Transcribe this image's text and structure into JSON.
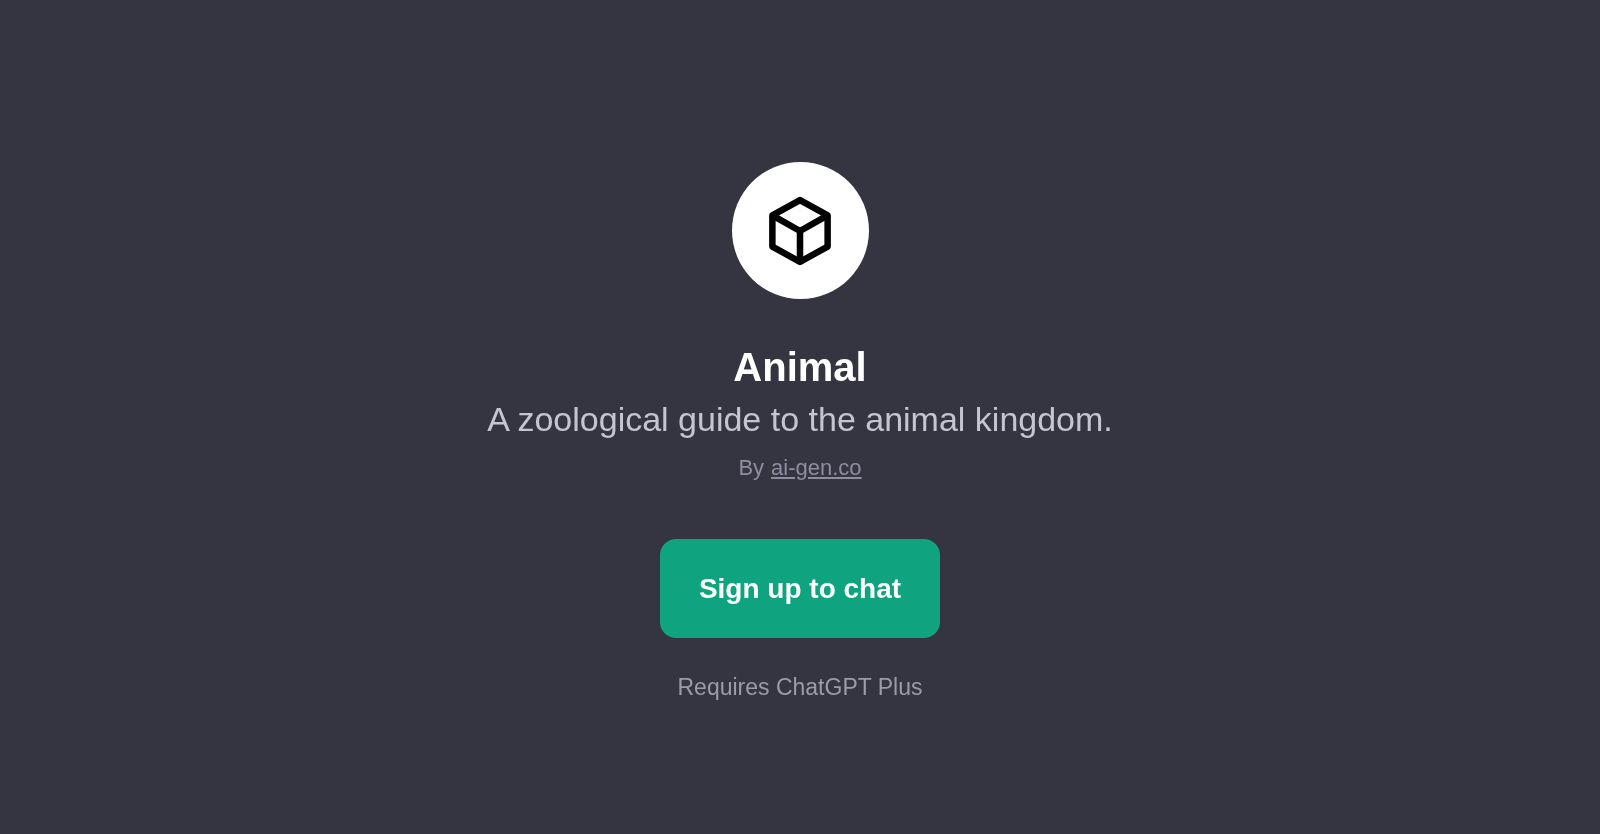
{
  "gpt": {
    "name": "Animal",
    "description": "A zoological guide to the animal kingdom.",
    "author_prefix": "By",
    "author_link": "ai-gen.co"
  },
  "signup_button": {
    "label": "Sign up to chat"
  },
  "requirement": "Requires ChatGPT Plus"
}
